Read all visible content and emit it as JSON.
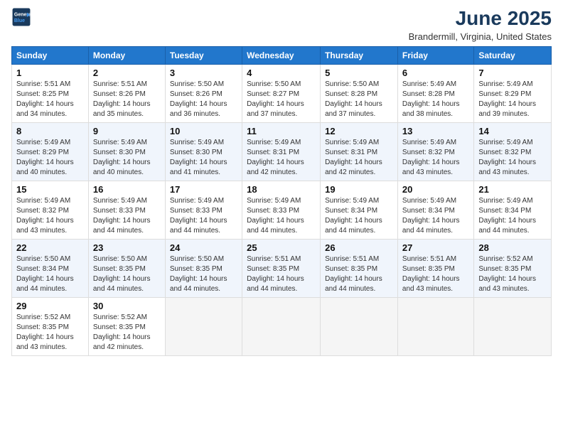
{
  "logo": {
    "line1": "General",
    "line2": "Blue"
  },
  "title": "June 2025",
  "subtitle": "Brandermill, Virginia, United States",
  "days_of_week": [
    "Sunday",
    "Monday",
    "Tuesday",
    "Wednesday",
    "Thursday",
    "Friday",
    "Saturday"
  ],
  "weeks": [
    [
      {
        "day": "1",
        "sunrise": "5:51 AM",
        "sunset": "8:25 PM",
        "daylight_hours": "14 hours and 34 minutes."
      },
      {
        "day": "2",
        "sunrise": "5:51 AM",
        "sunset": "8:26 PM",
        "daylight_hours": "14 hours and 35 minutes."
      },
      {
        "day": "3",
        "sunrise": "5:50 AM",
        "sunset": "8:26 PM",
        "daylight_hours": "14 hours and 36 minutes."
      },
      {
        "day": "4",
        "sunrise": "5:50 AM",
        "sunset": "8:27 PM",
        "daylight_hours": "14 hours and 37 minutes."
      },
      {
        "day": "5",
        "sunrise": "5:50 AM",
        "sunset": "8:28 PM",
        "daylight_hours": "14 hours and 37 minutes."
      },
      {
        "day": "6",
        "sunrise": "5:49 AM",
        "sunset": "8:28 PM",
        "daylight_hours": "14 hours and 38 minutes."
      },
      {
        "day": "7",
        "sunrise": "5:49 AM",
        "sunset": "8:29 PM",
        "daylight_hours": "14 hours and 39 minutes."
      }
    ],
    [
      {
        "day": "8",
        "sunrise": "5:49 AM",
        "sunset": "8:29 PM",
        "daylight_hours": "14 hours and 40 minutes."
      },
      {
        "day": "9",
        "sunrise": "5:49 AM",
        "sunset": "8:30 PM",
        "daylight_hours": "14 hours and 40 minutes."
      },
      {
        "day": "10",
        "sunrise": "5:49 AM",
        "sunset": "8:30 PM",
        "daylight_hours": "14 hours and 41 minutes."
      },
      {
        "day": "11",
        "sunrise": "5:49 AM",
        "sunset": "8:31 PM",
        "daylight_hours": "14 hours and 42 minutes."
      },
      {
        "day": "12",
        "sunrise": "5:49 AM",
        "sunset": "8:31 PM",
        "daylight_hours": "14 hours and 42 minutes."
      },
      {
        "day": "13",
        "sunrise": "5:49 AM",
        "sunset": "8:32 PM",
        "daylight_hours": "14 hours and 43 minutes."
      },
      {
        "day": "14",
        "sunrise": "5:49 AM",
        "sunset": "8:32 PM",
        "daylight_hours": "14 hours and 43 minutes."
      }
    ],
    [
      {
        "day": "15",
        "sunrise": "5:49 AM",
        "sunset": "8:32 PM",
        "daylight_hours": "14 hours and 43 minutes."
      },
      {
        "day": "16",
        "sunrise": "5:49 AM",
        "sunset": "8:33 PM",
        "daylight_hours": "14 hours and 44 minutes."
      },
      {
        "day": "17",
        "sunrise": "5:49 AM",
        "sunset": "8:33 PM",
        "daylight_hours": "14 hours and 44 minutes."
      },
      {
        "day": "18",
        "sunrise": "5:49 AM",
        "sunset": "8:33 PM",
        "daylight_hours": "14 hours and 44 minutes."
      },
      {
        "day": "19",
        "sunrise": "5:49 AM",
        "sunset": "8:34 PM",
        "daylight_hours": "14 hours and 44 minutes."
      },
      {
        "day": "20",
        "sunrise": "5:49 AM",
        "sunset": "8:34 PM",
        "daylight_hours": "14 hours and 44 minutes."
      },
      {
        "day": "21",
        "sunrise": "5:49 AM",
        "sunset": "8:34 PM",
        "daylight_hours": "14 hours and 44 minutes."
      }
    ],
    [
      {
        "day": "22",
        "sunrise": "5:50 AM",
        "sunset": "8:34 PM",
        "daylight_hours": "14 hours and 44 minutes."
      },
      {
        "day": "23",
        "sunrise": "5:50 AM",
        "sunset": "8:35 PM",
        "daylight_hours": "14 hours and 44 minutes."
      },
      {
        "day": "24",
        "sunrise": "5:50 AM",
        "sunset": "8:35 PM",
        "daylight_hours": "14 hours and 44 minutes."
      },
      {
        "day": "25",
        "sunrise": "5:51 AM",
        "sunset": "8:35 PM",
        "daylight_hours": "14 hours and 44 minutes."
      },
      {
        "day": "26",
        "sunrise": "5:51 AM",
        "sunset": "8:35 PM",
        "daylight_hours": "14 hours and 44 minutes."
      },
      {
        "day": "27",
        "sunrise": "5:51 AM",
        "sunset": "8:35 PM",
        "daylight_hours": "14 hours and 43 minutes."
      },
      {
        "day": "28",
        "sunrise": "5:52 AM",
        "sunset": "8:35 PM",
        "daylight_hours": "14 hours and 43 minutes."
      }
    ],
    [
      {
        "day": "29",
        "sunrise": "5:52 AM",
        "sunset": "8:35 PM",
        "daylight_hours": "14 hours and 43 minutes."
      },
      {
        "day": "30",
        "sunrise": "5:52 AM",
        "sunset": "8:35 PM",
        "daylight_hours": "14 hours and 42 minutes."
      },
      null,
      null,
      null,
      null,
      null
    ]
  ]
}
